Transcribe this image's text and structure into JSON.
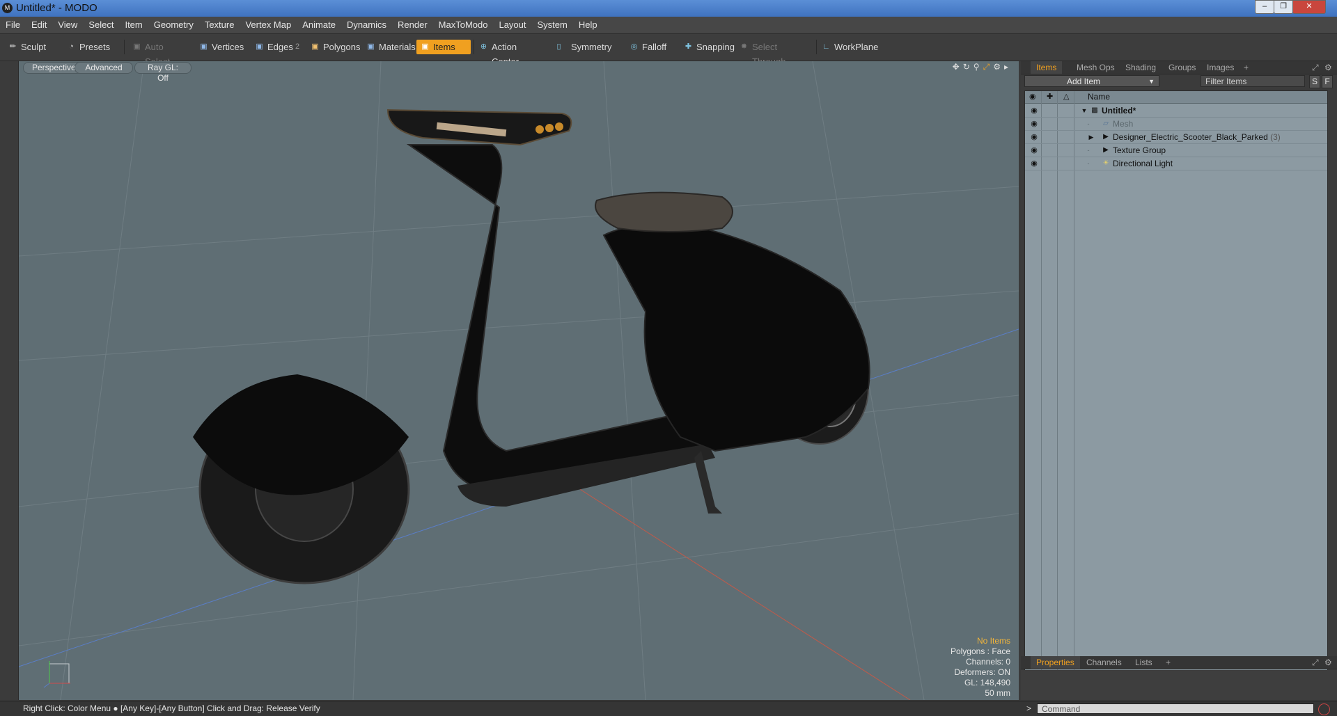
{
  "window": {
    "title": "Untitled* - MODO",
    "logo_icon": "modo-logo-icon"
  },
  "menu": [
    "File",
    "Edit",
    "View",
    "Select",
    "Item",
    "Geometry",
    "Texture",
    "Vertex Map",
    "Animate",
    "Dynamics",
    "Render",
    "MaxToModo",
    "Layout",
    "System",
    "Help"
  ],
  "toolbar": {
    "sculpt": "Sculpt",
    "presets": "Presets",
    "auto_select": "Auto Select",
    "vertices": "Vertices",
    "edges": "Edges",
    "edges_count": "2",
    "polygons": "Polygons",
    "materials": "Materials",
    "items": "Items",
    "action_center": "Action Center",
    "symmetry": "Symmetry",
    "falloff": "Falloff",
    "snapping": "Snapping",
    "select_through": "Select Through",
    "workplane": "WorkPlane",
    "active_color": "#f0a020"
  },
  "viewport": {
    "view": "Perspective",
    "mode": "Advanced",
    "raygl": "Ray GL: Off",
    "info": {
      "selection": "No Items",
      "polygons": "Polygons : Face",
      "channels": "Channels: 0",
      "deformers": "Deformers: ON",
      "gl": "GL: 148,490",
      "lens": "50 mm"
    },
    "background_color": "#5f6e74"
  },
  "items_panel": {
    "tabs": [
      "Items",
      "Mesh Ops",
      "Shading",
      "Groups",
      "Images"
    ],
    "add_item": "Add Item",
    "filter_placeholder": "Filter Items",
    "s_btn": "S",
    "f_btn": "F",
    "column_name": "Name",
    "tree": [
      {
        "label": "Untitled*",
        "icon": "scene-icon",
        "bold": true
      },
      {
        "label": "Mesh",
        "icon": "mesh-icon",
        "dim": true
      },
      {
        "label": "Designer_Electric_Scooter_Black_Parked",
        "count": "(3)",
        "icon": "locator-icon"
      },
      {
        "label": "Texture Group",
        "icon": "group-icon"
      },
      {
        "label": "Directional Light",
        "icon": "light-icon"
      }
    ]
  },
  "properties_panel": {
    "tabs": [
      "Properties",
      "Channels",
      "Lists"
    ]
  },
  "statusbar": {
    "hint": "Right Click: Color Menu ● [Any Key]-[Any Button] Click and Drag: Release Verify",
    "command_placeholder": "Command"
  }
}
